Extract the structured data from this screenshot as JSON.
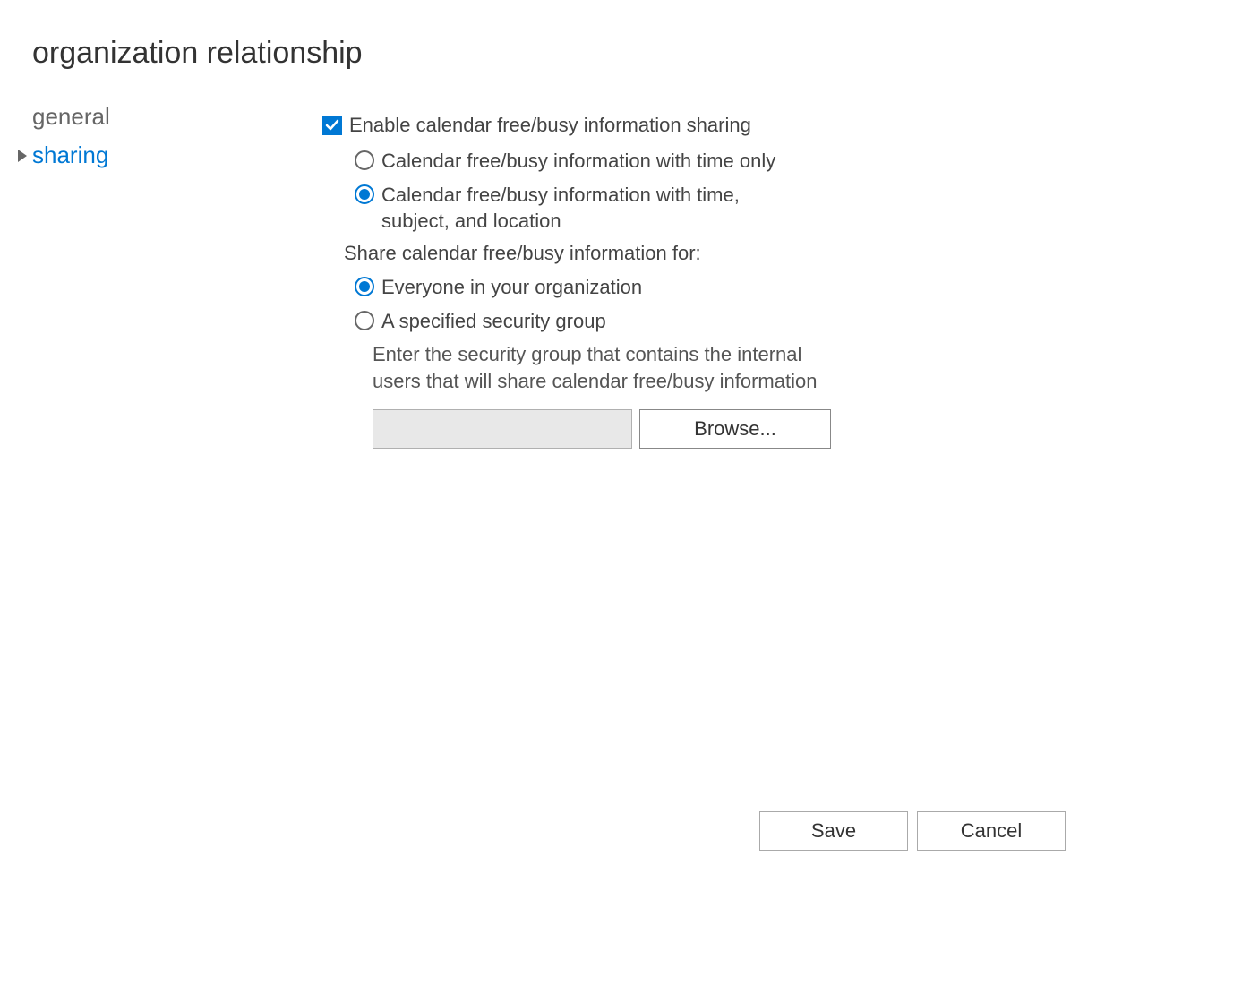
{
  "page": {
    "title": "organization relationship"
  },
  "sidebar": {
    "items": [
      {
        "label": "general",
        "active": false
      },
      {
        "label": "sharing",
        "active": true
      }
    ]
  },
  "main": {
    "enable_checkbox": {
      "label": "Enable calendar free/busy information sharing",
      "checked": true
    },
    "detail_radios": {
      "options": [
        {
          "label": "Calendar free/busy information with time only",
          "selected": false
        },
        {
          "label": "Calendar free/busy information with time, subject, and location",
          "selected": true
        }
      ]
    },
    "share_for_label": "Share calendar free/busy information for:",
    "share_for_radios": {
      "options": [
        {
          "label": "Everyone in your organization",
          "selected": true
        },
        {
          "label": "A specified security group",
          "selected": false
        }
      ]
    },
    "security_group_help": "Enter the security group that contains the internal users that will share calendar free/busy information",
    "security_group_input": {
      "value": "",
      "disabled": true
    },
    "browse_button": "Browse..."
  },
  "footer": {
    "save": "Save",
    "cancel": "Cancel"
  }
}
